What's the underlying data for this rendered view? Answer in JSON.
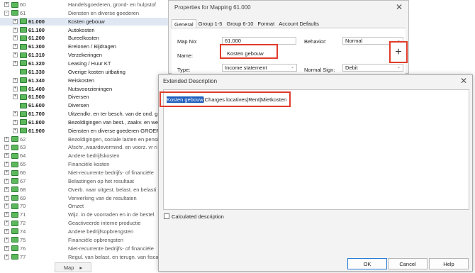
{
  "tree": {
    "rows": [
      {
        "code": "60",
        "desc": "Handelsgoederen, grond- en hulpstof",
        "exp": "+",
        "style": "grey",
        "sel": false,
        "indent": 0
      },
      {
        "code": "61",
        "desc": "Diensten en diverse goederen",
        "exp": "-",
        "style": "grey",
        "sel": false,
        "indent": 0
      },
      {
        "code": "61.000",
        "desc": "Kosten gebouw",
        "exp": "+",
        "style": "bold",
        "sel": true,
        "indent": 1
      },
      {
        "code": "61.100",
        "desc": "Autokosten",
        "exp": "+",
        "style": "bold",
        "sel": false,
        "indent": 1
      },
      {
        "code": "61.200",
        "desc": "Bureelkosten",
        "exp": "+",
        "style": "bold",
        "sel": false,
        "indent": 1
      },
      {
        "code": "61.300",
        "desc": "Erelonen / Bijdragen",
        "exp": "+",
        "style": "bold",
        "sel": false,
        "indent": 1
      },
      {
        "code": "61.310",
        "desc": "Verzekeringen",
        "exp": "+",
        "style": "bold",
        "sel": false,
        "indent": 1
      },
      {
        "code": "61.320",
        "desc": "Leasing / Huur KT",
        "exp": "+",
        "style": "bold",
        "sel": false,
        "indent": 1
      },
      {
        "code": "61.330",
        "desc": "Overige kosten uitbating",
        "exp": "",
        "style": "bold",
        "sel": false,
        "indent": 1
      },
      {
        "code": "61.340",
        "desc": "Reiskosten",
        "exp": "+",
        "style": "bold",
        "sel": false,
        "indent": 1
      },
      {
        "code": "61.400",
        "desc": "Nutsvoorzieningen",
        "exp": "+",
        "style": "bold",
        "sel": false,
        "indent": 1
      },
      {
        "code": "61.500",
        "desc": "Diversen",
        "exp": "+",
        "style": "bold",
        "sel": false,
        "indent": 1
      },
      {
        "code": "61.600",
        "desc": "Diversen",
        "exp": "",
        "style": "bold",
        "sel": false,
        "indent": 1
      },
      {
        "code": "61.700",
        "desc": "Uitzendkr. en ter besch. van de ond. g",
        "exp": "+",
        "style": "bold",
        "sel": false,
        "indent": 1
      },
      {
        "code": "61.800",
        "desc": "Bezoldigingen van best., zaakv. en we",
        "exp": "+",
        "style": "bold",
        "sel": false,
        "indent": 1
      },
      {
        "code": "61.900",
        "desc": "Diensten en diverse goederen GROEP",
        "exp": "+",
        "style": "bold",
        "sel": false,
        "indent": 1
      },
      {
        "code": "62",
        "desc": "Bezoldigingen, sociale lasten en pensi",
        "exp": "+",
        "style": "grey",
        "sel": false,
        "indent": 0
      },
      {
        "code": "63",
        "desc": "Afschr.,waardevermind. en voorz. vr ri",
        "exp": "+",
        "style": "grey",
        "sel": false,
        "indent": 0
      },
      {
        "code": "64",
        "desc": "Andere bedrijfskosten",
        "exp": "+",
        "style": "grey",
        "sel": false,
        "indent": 0
      },
      {
        "code": "65",
        "desc": "Financiële kosten",
        "exp": "+",
        "style": "grey",
        "sel": false,
        "indent": 0
      },
      {
        "code": "66",
        "desc": "Niet-recurrente bedrijfs- of financiële",
        "exp": "+",
        "style": "grey",
        "sel": false,
        "indent": 0
      },
      {
        "code": "67",
        "desc": "Belastingen op het resultaat",
        "exp": "+",
        "style": "grey",
        "sel": false,
        "indent": 0
      },
      {
        "code": "68",
        "desc": "Overb. naar uitgest. belast. en belasti",
        "exp": "+",
        "style": "grey",
        "sel": false,
        "indent": 0
      },
      {
        "code": "69",
        "desc": "Verwerking van de resultaten",
        "exp": "+",
        "style": "grey",
        "sel": false,
        "indent": 0
      },
      {
        "code": "70",
        "desc": "Omzet",
        "exp": "+",
        "style": "grey",
        "sel": false,
        "indent": 0
      },
      {
        "code": "71",
        "desc": "Wijz. in de voorraden en in de bestel",
        "exp": "+",
        "style": "grey",
        "sel": false,
        "indent": 0
      },
      {
        "code": "72",
        "desc": "Geactiveerde interne productie",
        "exp": "+",
        "style": "grey",
        "sel": false,
        "indent": 0
      },
      {
        "code": "74",
        "desc": "Andere bedrijfsopbrengsten",
        "exp": "+",
        "style": "grey",
        "sel": false,
        "indent": 0
      },
      {
        "code": "75",
        "desc": "Financiële opbrengsten",
        "exp": "+",
        "style": "grey",
        "sel": false,
        "indent": 0
      },
      {
        "code": "76",
        "desc": "Niet-recurrente bedrijfs- of financiële",
        "exp": "+",
        "style": "grey",
        "sel": false,
        "indent": 0
      },
      {
        "code": "77",
        "desc": "Regul. van belast. en terugn. van fisca",
        "exp": "+",
        "style": "grey",
        "sel": false,
        "indent": 0
      }
    ],
    "map_button": "Map",
    "map_arrow": "▸"
  },
  "properties": {
    "title": "Properties for Mapping 61.000",
    "close": "✕",
    "tabs": [
      "General",
      "Group 1-5",
      "Group 6-10",
      "Format",
      "Account Defaults"
    ],
    "map_no_label": "Map No:",
    "map_no_value": "61.000",
    "behavior_label": "Behavior:",
    "behavior_value": "Normal",
    "name_label": "Name:",
    "name_value": "Kosten gebouw",
    "type_label": "Type:",
    "type_value": "Income statement",
    "normal_sign_label": "Normal Sign:",
    "normal_sign_value": "Debit",
    "plus_symbol": "+",
    "dropdown_arrow": "⌄"
  },
  "extended": {
    "title": "Extended Description",
    "close": "✕",
    "text_highlight": "Kosten gebouw",
    "text_rest": "|Charges locatives|Rent|Mietkosten",
    "calculated_label": "Calculated description",
    "ok": "OK",
    "cancel": "Cancel",
    "help": "Help"
  },
  "colors": {
    "annotation_red": "#e03c2c",
    "folder_green": "#5cb85c",
    "selection_blue": "#1e5fbf"
  }
}
